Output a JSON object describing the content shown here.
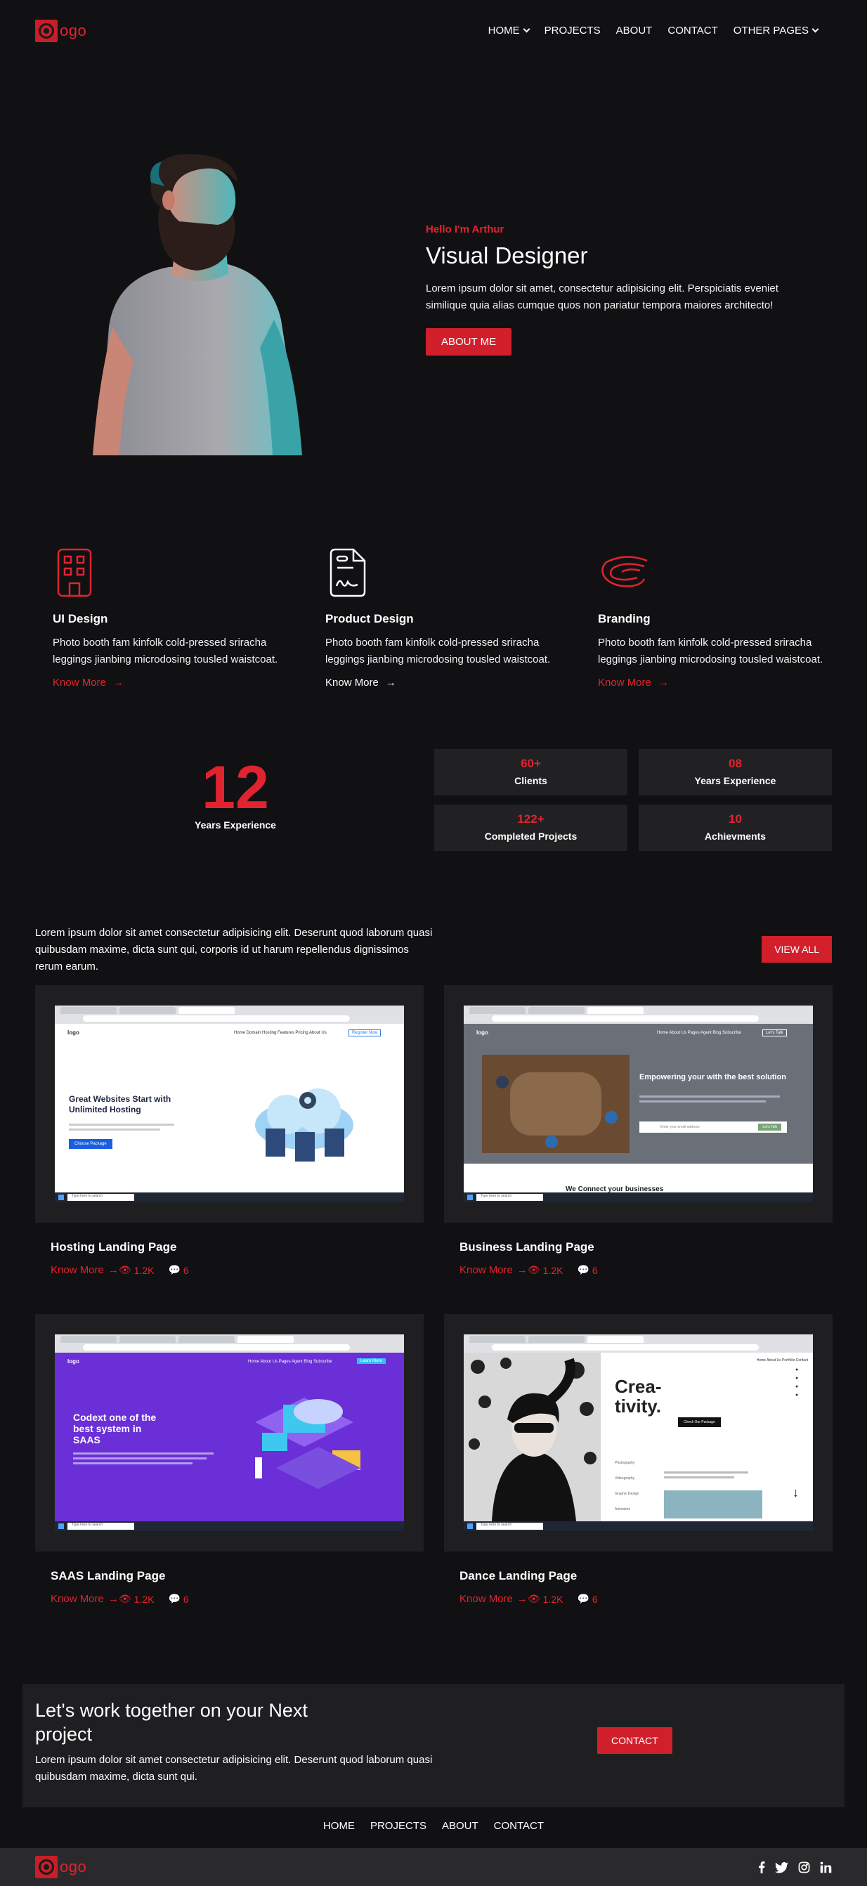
{
  "nav": {
    "logo_text": "ogo",
    "items": [
      {
        "label": "HOME",
        "dropdown": true
      },
      {
        "label": "PROJECTS",
        "dropdown": false
      },
      {
        "label": "ABOUT",
        "dropdown": false
      },
      {
        "label": "CONTACT",
        "dropdown": false
      },
      {
        "label": "OTHER PAGES",
        "dropdown": true
      }
    ]
  },
  "hero": {
    "greeting": "Hello I'm Arthur",
    "title": "Visual Designer",
    "description": "Lorem ipsum dolor sit amet, consectetur adipisicing elit. Perspiciatis eveniet similique quia alias cumque quos non pariatur tempora maiores architecto!",
    "button": "ABOUT ME"
  },
  "services": [
    {
      "icon": "building-icon",
      "title": "UI Design",
      "text": "Photo booth fam kinfolk cold-pressed sriracha leggings jianbing microdosing tousled waistcoat.",
      "link": "Know More",
      "link_color": "#e0242f"
    },
    {
      "icon": "document-signature-icon",
      "title": "Product Design",
      "text": "Photo booth fam kinfolk cold-pressed sriracha leggings jianbing microdosing tousled waistcoat.",
      "link": "Know More",
      "link_color": "#ffffff"
    },
    {
      "icon": "branding-swirl-icon",
      "title": "Branding",
      "text": "Photo booth fam kinfolk cold-pressed sriracha leggings jianbing microdosing tousled waistcoat.",
      "link": "Know More",
      "link_color": "#e0242f"
    }
  ],
  "stats": {
    "big_number": "12",
    "big_label": "Years Experience",
    "boxes": [
      {
        "value": "60+",
        "label": "Clients"
      },
      {
        "value": "08",
        "label": "Years Experience"
      },
      {
        "value": "122+",
        "label": "Completed Projects"
      },
      {
        "value": "10",
        "label": "Achievments"
      }
    ]
  },
  "projects": {
    "intro": "Lorem ipsum dolor sit amet consectetur adipisicing elit. Deserunt quod laborum quasi quibusdam maxime, dicta sunt qui, corporis id ut harum repellendus dignissimos rerum earum.",
    "view_all": "VIEW ALL",
    "items": [
      {
        "title": "Hosting Landing Page",
        "link": "Know More",
        "views": "1.2K",
        "comments": "6",
        "shot": {
          "headline": "Great Websites Start with Unlimited Hosting",
          "cta": "Choose Package",
          "logo": "logo",
          "nav": "Home  Domain  Hosting  Features  Pricing  About Us",
          "nav_btn": "Register Now",
          "search": "Type here to search"
        }
      },
      {
        "title": "Business Landing Page",
        "link": "Know More",
        "views": "1.2K",
        "comments": "6",
        "shot": {
          "headline": "Empowering your with the best solution",
          "subhead": "We Connect your businesses",
          "logo": "logo",
          "nav": "Home  About Us  Pages  Agent  Blog  Subscribe",
          "nav_btn": "Let's Talk",
          "email_placeholder": "Enter your email address",
          "subscribe": "Let's Talk",
          "search": "Type here to search"
        }
      },
      {
        "title": "SAAS Landing Page",
        "link": "Know More",
        "views": "1.2K",
        "comments": "6",
        "shot": {
          "headline": "Codext one of the best system in SAAS",
          "logo": "logo",
          "nav": "Home  About Us  Pages  Agent  Blog  Subscribe",
          "nav_btn": "Learn More",
          "search": "Type here to search"
        }
      },
      {
        "title": "Dance Landing Page",
        "link": "Know More",
        "views": "1.2K",
        "comments": "6",
        "shot": {
          "headline": "Crea-tivity.",
          "cta": "Check Our Package",
          "nav": "Home  About Us  Portfolio  Contact",
          "list": [
            "Photography",
            "Videography",
            "Graphic Design",
            "Animation"
          ],
          "search": "Type here to search"
        }
      }
    ]
  },
  "cta": {
    "title": "Let's work together on your Next project",
    "text": "Lorem ipsum dolor sit amet consectetur adipisicing elit. Deserunt quod laborum quasi quibusdam maxime, dicta sunt qui.",
    "button": "CONTACT"
  },
  "footer": {
    "links": [
      "HOME",
      "PROJECTS",
      "ABOUT",
      "CONTACT"
    ],
    "logo_text": "ogo",
    "socials": [
      "facebook-icon",
      "twitter-icon",
      "instagram-icon",
      "linkedin-icon"
    ]
  },
  "colors": {
    "accent": "#e0242f",
    "background": "#111113",
    "card": "#1f1f21"
  }
}
